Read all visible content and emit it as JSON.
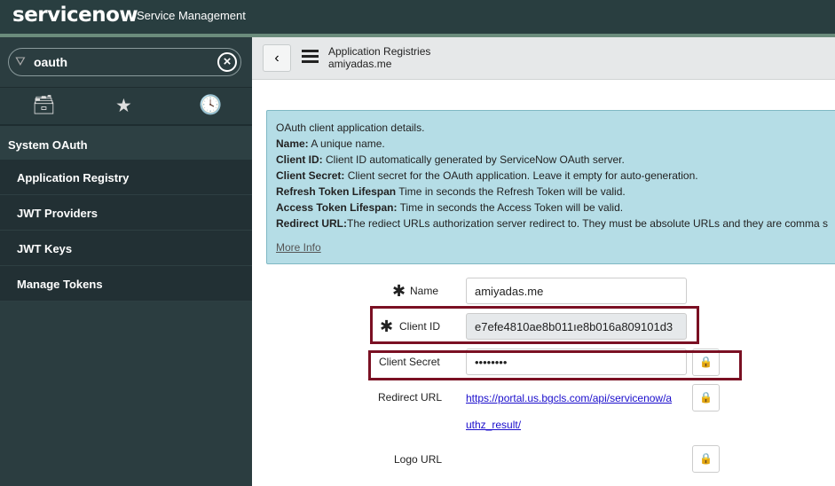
{
  "header": {
    "logo": "servicenow",
    "product": "Service Management"
  },
  "sidebar": {
    "search_value": "oauth",
    "section": "System OAuth",
    "items": [
      "Application Registry",
      "JWT Providers",
      "JWT Keys",
      "Manage Tokens"
    ]
  },
  "main": {
    "title": "Application Registries",
    "subtitle": "amiyadas.me"
  },
  "info": {
    "intro": "OAuth client application details.",
    "lines": [
      {
        "k": "Name:",
        "v": " A unique name."
      },
      {
        "k": "Client ID:",
        "v": " Client ID automatically generated by ServiceNow OAuth server."
      },
      {
        "k": "Client Secret:",
        "v": " Client secret for the OAuth application. Leave it empty for auto-generation."
      },
      {
        "k": "Refresh Token Lifespan",
        "v": " Time in seconds the Refresh Token will be valid."
      },
      {
        "k": "Access Token Lifespan:",
        "v": " Time in seconds the Access Token will be valid."
      },
      {
        "k": "Redirect URL:",
        "v": "The rediect URLs authorization server redirect to. They must be absolute URLs and they are comma s"
      }
    ],
    "more": "More Info"
  },
  "form": {
    "name_label": "Name",
    "name_value": "amiyadas.me",
    "client_id_label": "Client ID",
    "client_id_value": "e7efe4810ae8b011ıe8b016a809101d3",
    "secret_label": "Client Secret",
    "secret_value": "••••••••",
    "redirect_label": "Redirect URL",
    "redirect_line1": "https://portal.us.bgcls.com/api/servicenow/a",
    "redirect_line2": "uthz_result/",
    "logo_label": "Logo URL"
  },
  "colors": {
    "header": "#293e40",
    "highlight": "#7a1023",
    "info_bg": "#b5dde6"
  }
}
